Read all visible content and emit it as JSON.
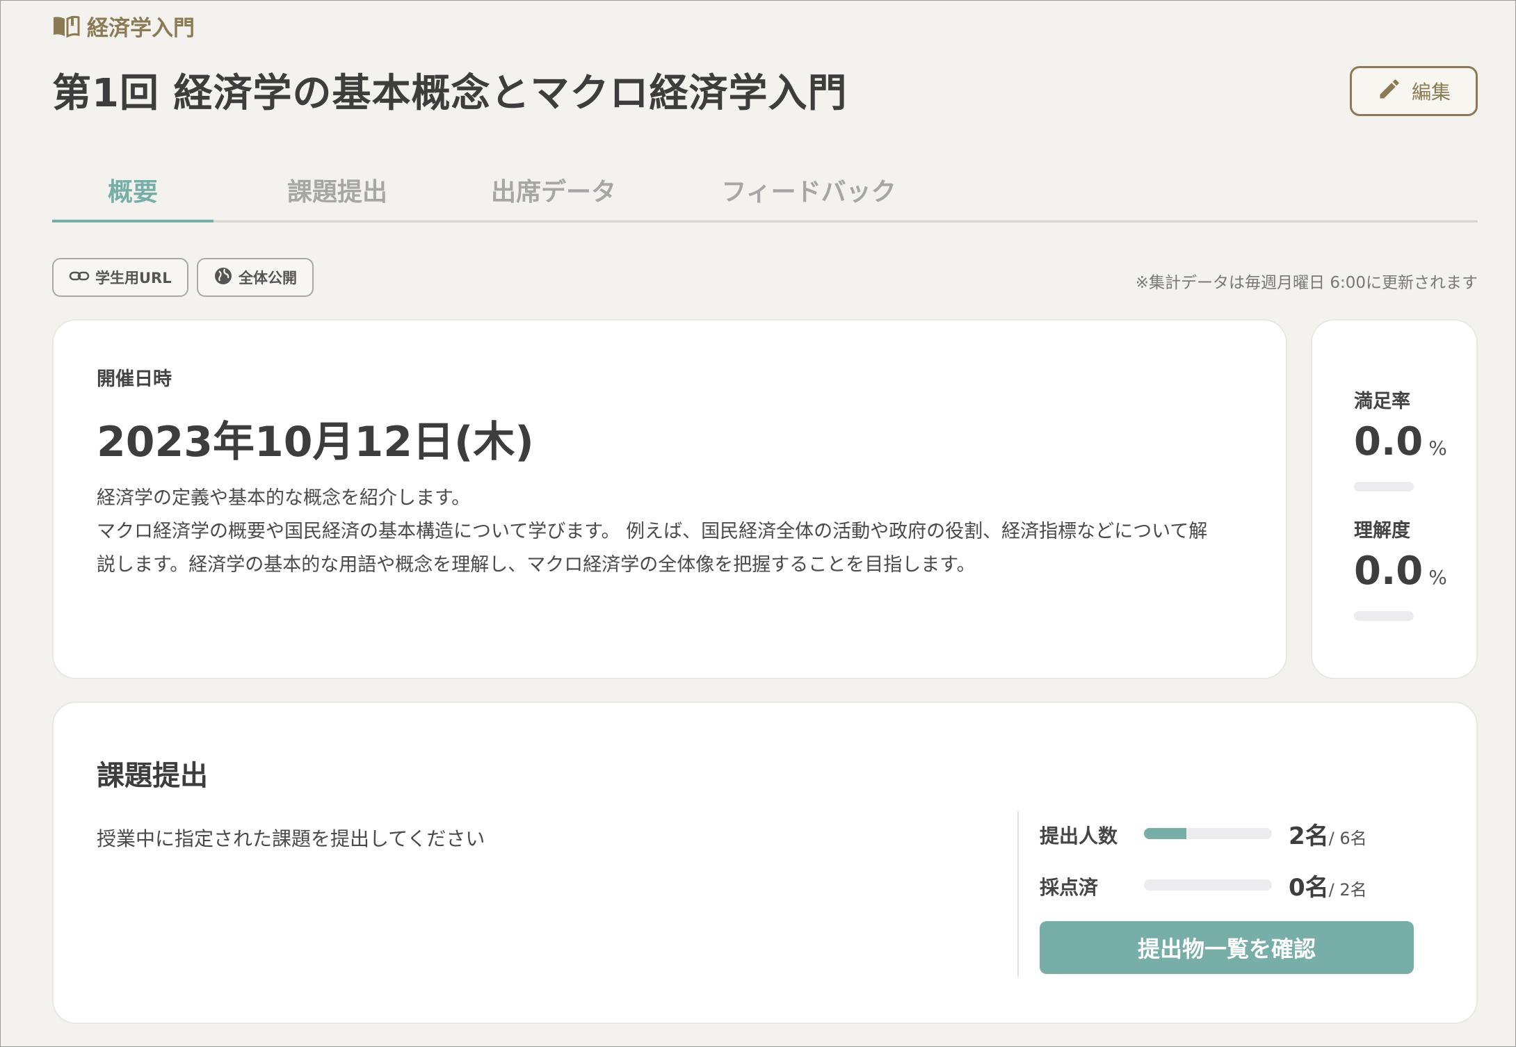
{
  "course": {
    "name": "経済学入門",
    "icon": "book-icon"
  },
  "lecture": {
    "title": "第1回 経済学の基本概念とマクロ経済学入門"
  },
  "header": {
    "edit_label": "編集"
  },
  "tabs": [
    {
      "label": "概要",
      "active": true
    },
    {
      "label": "課題提出",
      "active": false
    },
    {
      "label": "出席データ",
      "active": false
    },
    {
      "label": "フィードバック",
      "active": false
    }
  ],
  "chips": {
    "student_url": "学生用URL",
    "public": "全体公開"
  },
  "update_note": "※集計データは毎週月曜日 6:00に更新されます",
  "overview": {
    "date_label": "開催日時",
    "date": "2023年10月12日(木)",
    "description_lines": [
      "経済学の定義や基本的な概念を紹介します。",
      "マクロ経済学の概要や国民経済の基本構造について学びます。 例えば、国民経済全体の活動や政府の役割、経済指標などについて解",
      "説します。経済学の基本的な用語や概念を理解し、マクロ経済学の全体像を把握することを目指します。"
    ]
  },
  "stats": {
    "satisfaction": {
      "label": "満足率",
      "value": "0.0",
      "unit": "%",
      "fraction": 0.0
    },
    "understanding": {
      "label": "理解度",
      "value": "0.0",
      "unit": "%",
      "fraction": 0.0
    }
  },
  "assignment": {
    "title": "課題提出",
    "description": "授業中に指定された課題を提出してください",
    "submitted": {
      "label": "提出人数",
      "count": "2名",
      "total": "/ 6名",
      "fraction": 0.333
    },
    "graded": {
      "label": "採点済",
      "count": "0名",
      "total": "/ 2名",
      "fraction": 0.0
    },
    "button_label": "提出物一覧を確認"
  },
  "colors": {
    "accent": "#78aea8",
    "brand": "#8c7a55",
    "background": "#f3f2ee"
  }
}
